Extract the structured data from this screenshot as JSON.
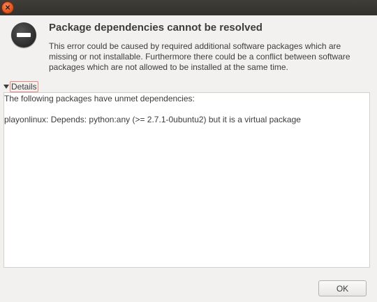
{
  "window": {
    "close_glyph": "×"
  },
  "dialog": {
    "icon": "error-icon",
    "heading": "Package dependencies cannot be resolved",
    "message": "This error could be caused by required additional software packages which are missing or not installable. Furthermore there could be a conflict between software packages which are not allowed to be installed at the same time.",
    "details_label": "Details",
    "details_expanded": true,
    "details_lines": [
      "The following packages have unmet dependencies:",
      "",
      "playonlinux: Depends: python:any (>= 2.7.1-0ubuntu2) but it is a virtual package"
    ],
    "ok_label": "OK"
  }
}
